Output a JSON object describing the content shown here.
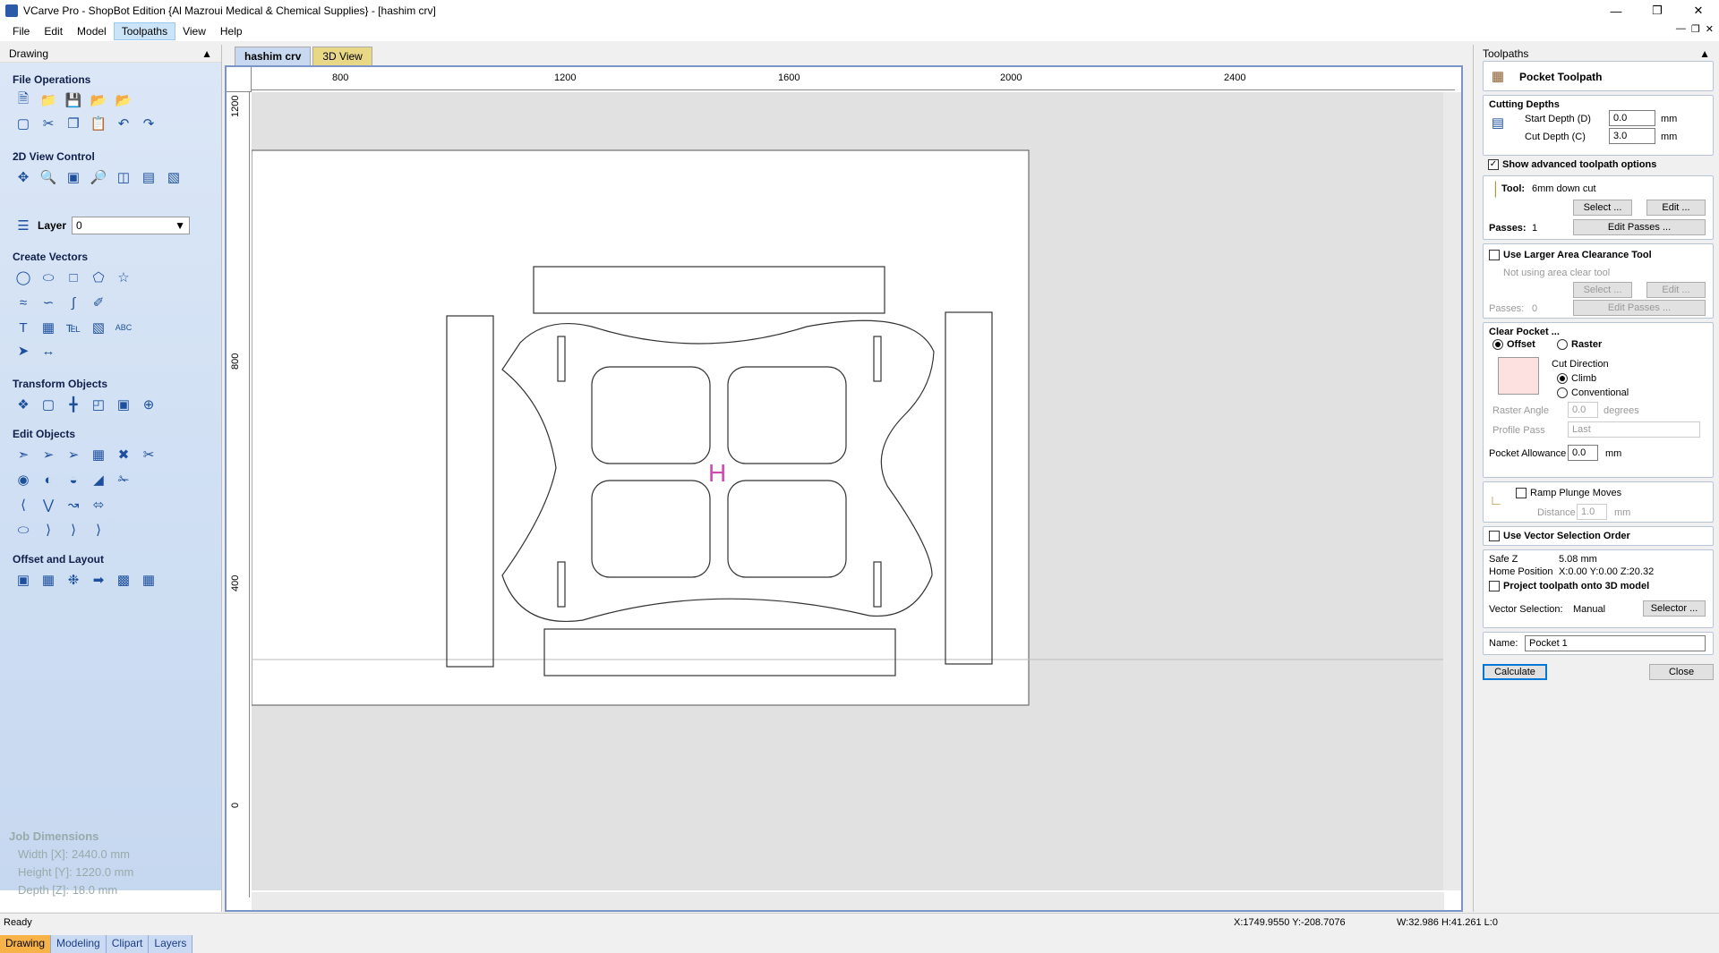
{
  "window": {
    "title": "VCarve Pro - ShopBot Edition {Al Mazroui Medical & Chemical Supplies} - [hashim crv]"
  },
  "menu": [
    "File",
    "Edit",
    "Model",
    "Toolpaths",
    "View",
    "Help"
  ],
  "left_panel": {
    "header": "Drawing",
    "sections": {
      "file_ops": "File Operations",
      "view_control": "2D View Control",
      "layer": "Layer",
      "layer_value": "0",
      "create_vectors": "Create Vectors",
      "transform": "Transform Objects",
      "edit": "Edit Objects",
      "offset": "Offset and Layout"
    },
    "job_dimensions": {
      "heading": "Job Dimensions",
      "width": "Width  [X]: 2440.0 mm",
      "height": "Height [Y]: 1220.0 mm",
      "depth": "Depth  [Z]: 18.0 mm"
    },
    "tabs": [
      "Drawing",
      "Modeling",
      "Clipart",
      "Layers"
    ]
  },
  "doc_tabs": [
    "hashim crv",
    "3D View"
  ],
  "rulers": {
    "h": [
      "800",
      "1200",
      "1600",
      "2000",
      "2400"
    ],
    "v": [
      "1200",
      "800",
      "400",
      "0"
    ]
  },
  "right_panel": {
    "header": "Toolpaths",
    "title": "Pocket Toolpath",
    "cutting_depths": "Cutting Depths",
    "start_depth_label": "Start Depth (D)",
    "start_depth": "0.0",
    "cut_depth_label": "Cut Depth (C)",
    "cut_depth": "3.0",
    "unit": "mm",
    "show_advanced": "Show advanced toolpath options",
    "tool_label": "Tool:",
    "tool_name": "6mm down cut",
    "select_btn": "Select ...",
    "edit_btn": "Edit ...",
    "passes_label": "Passes:",
    "passes": "1",
    "edit_passes_btn": "Edit Passes ...",
    "larger_area": "Use Larger Area Clearance Tool",
    "not_using": "Not using area clear tool",
    "passes2": "0",
    "clear_pocket": "Clear Pocket ...",
    "offset": "Offset",
    "raster": "Raster",
    "cut_direction": "Cut Direction",
    "climb": "Climb",
    "conventional": "Conventional",
    "raster_angle_label": "Raster Angle",
    "raster_angle": "0.0",
    "degrees": "degrees",
    "profile_pass_label": "Profile Pass",
    "profile_pass": "Last",
    "pocket_allowance_label": "Pocket Allowance",
    "pocket_allowance": "0.0",
    "ramp": "Ramp Plunge Moves",
    "distance_label": "Distance",
    "distance": "1.0",
    "vector_order": "Use Vector Selection Order",
    "safe_z_label": "Safe Z",
    "safe_z": "5.08 mm",
    "home_label": "Home Position",
    "home": "X:0.00 Y:0.00 Z:20.32",
    "project": "Project toolpath onto 3D model",
    "vector_sel_label": "Vector Selection:",
    "vector_sel": "Manual",
    "selector_btn": "Selector ...",
    "name_label": "Name:",
    "name_value": "Pocket 1",
    "calculate": "Calculate",
    "close": "Close"
  },
  "status": {
    "ready": "Ready",
    "coords": "X:1749.9550 Y:-208.7076",
    "size": "W:32.986  H:41.261  L:0"
  },
  "colors": {
    "accent": "#f7b347",
    "panel": "#c6d8f0",
    "frame": "#7c95c9"
  }
}
